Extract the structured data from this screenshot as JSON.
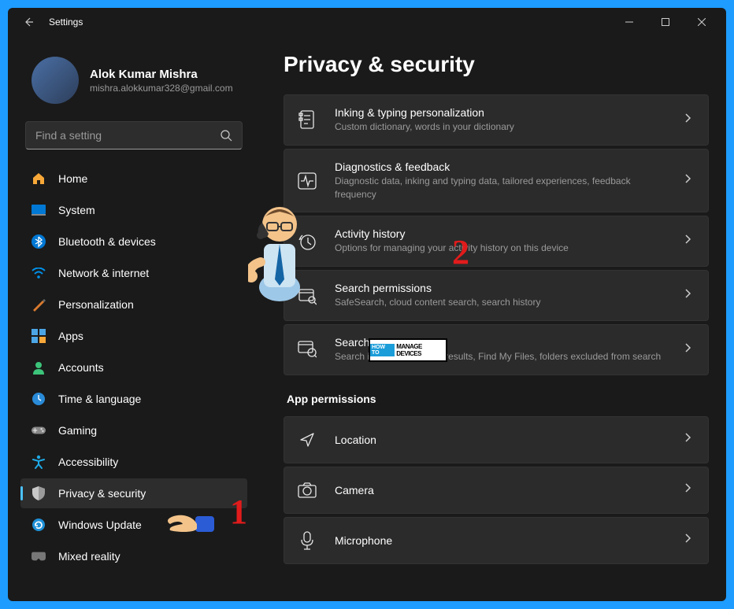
{
  "app": {
    "title": "Settings"
  },
  "profile": {
    "name": "Alok Kumar Mishra",
    "email": "mishra.alokkumar328@gmail.com"
  },
  "search": {
    "placeholder": "Find a setting"
  },
  "nav": [
    {
      "id": "home",
      "label": "Home",
      "icon": "home",
      "selected": false
    },
    {
      "id": "system",
      "label": "System",
      "icon": "system",
      "selected": false
    },
    {
      "id": "bluetooth",
      "label": "Bluetooth & devices",
      "icon": "bluetooth",
      "selected": false
    },
    {
      "id": "network",
      "label": "Network & internet",
      "icon": "wifi",
      "selected": false
    },
    {
      "id": "personalization",
      "label": "Personalization",
      "icon": "brush",
      "selected": false
    },
    {
      "id": "apps",
      "label": "Apps",
      "icon": "apps",
      "selected": false
    },
    {
      "id": "accounts",
      "label": "Accounts",
      "icon": "accounts",
      "selected": false
    },
    {
      "id": "time",
      "label": "Time & language",
      "icon": "clock",
      "selected": false
    },
    {
      "id": "gaming",
      "label": "Gaming",
      "icon": "gaming",
      "selected": false
    },
    {
      "id": "accessibility",
      "label": "Accessibility",
      "icon": "accessibility",
      "selected": false
    },
    {
      "id": "privacy",
      "label": "Privacy & security",
      "icon": "shield",
      "selected": true
    },
    {
      "id": "update",
      "label": "Windows Update",
      "icon": "update",
      "selected": false
    },
    {
      "id": "mixed",
      "label": "Mixed reality",
      "icon": "mixed",
      "selected": false
    }
  ],
  "page": {
    "title": "Privacy & security"
  },
  "cards": [
    {
      "id": "inking",
      "title": "Inking & typing personalization",
      "subtitle": "Custom dictionary, words in your dictionary"
    },
    {
      "id": "diagnostics",
      "title": "Diagnostics & feedback",
      "subtitle": "Diagnostic data, inking and typing data, tailored experiences, feedback frequency"
    },
    {
      "id": "activity",
      "title": "Activity history",
      "subtitle": "Options for managing your activity history on this device"
    },
    {
      "id": "searchperm",
      "title": "Search permissions",
      "subtitle": "SafeSearch, cloud content search, search history"
    },
    {
      "id": "searchwin",
      "title": "Searching Windows",
      "subtitle": "Search indexing for faster results, Find My Files, folders excluded from search"
    }
  ],
  "section": {
    "title": "App permissions"
  },
  "perm_cards": [
    {
      "id": "location",
      "title": "Location"
    },
    {
      "id": "camera",
      "title": "Camera"
    },
    {
      "id": "microphone",
      "title": "Microphone"
    }
  ],
  "annotations": {
    "one": "1",
    "two": "2"
  },
  "watermark": {
    "how": "HOW TO",
    "text": "MANAGE DEVICES"
  }
}
